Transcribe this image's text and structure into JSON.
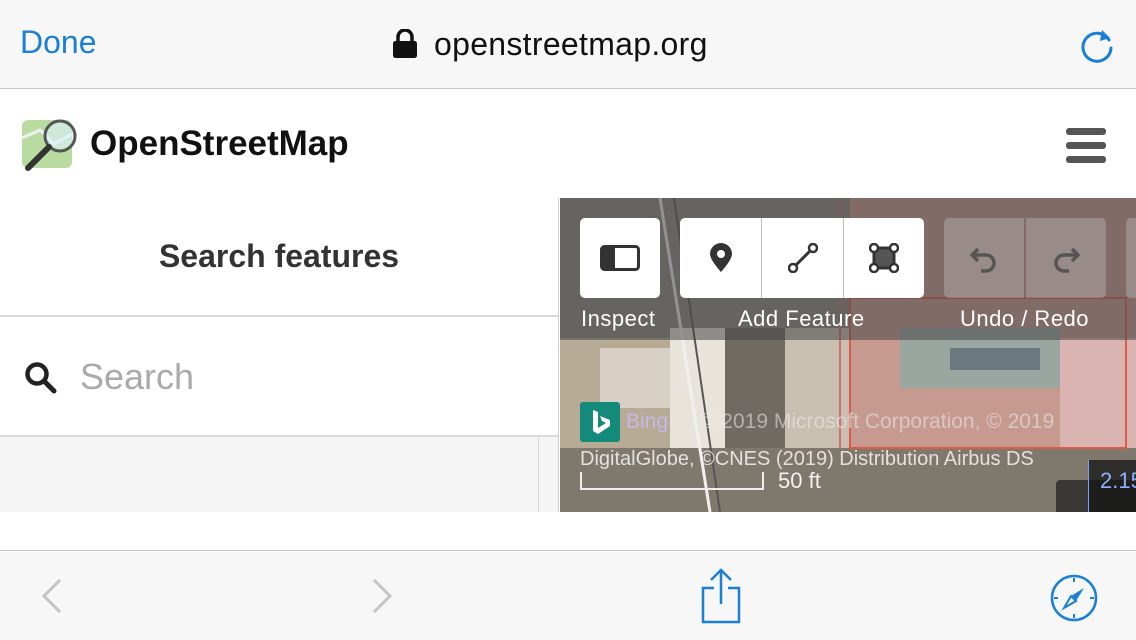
{
  "browser": {
    "done_label": "Done",
    "url": "openstreetmap.org",
    "icons": {
      "lock": "lock-icon",
      "reload": "reload-icon"
    },
    "accent_color": "#1a7fd6"
  },
  "header": {
    "title": "OpenStreetMap",
    "icons": {
      "logo": "osm-logo-icon",
      "menu": "hamburger-menu-icon"
    }
  },
  "sidebar": {
    "title": "Search features",
    "search": {
      "placeholder": "Search",
      "value": ""
    }
  },
  "map": {
    "toolbar": {
      "inspect_label": "Inspect",
      "add_feature_label": "Add Feature",
      "undo_redo_label": "Undo / Redo",
      "buttons": [
        "inspect-panel-icon",
        "point-icon",
        "line-icon",
        "area-icon",
        "undo-icon",
        "redo-icon"
      ],
      "undo_enabled": false,
      "redo_enabled": false
    },
    "attribution": {
      "provider": "Bing",
      "line1": "© 2019 Microsoft Corporation, © 2019",
      "line2": "DigitalGlobe, ©CNES (2019) Distribution Airbus DS"
    },
    "scale_label": "50 ft",
    "coordinate_partial": "2.15"
  },
  "bottom_toolbar": {
    "back_enabled": false,
    "forward_enabled": false,
    "icons": [
      "back-chevron-icon",
      "forward-chevron-icon",
      "share-icon",
      "compass-icon"
    ]
  }
}
